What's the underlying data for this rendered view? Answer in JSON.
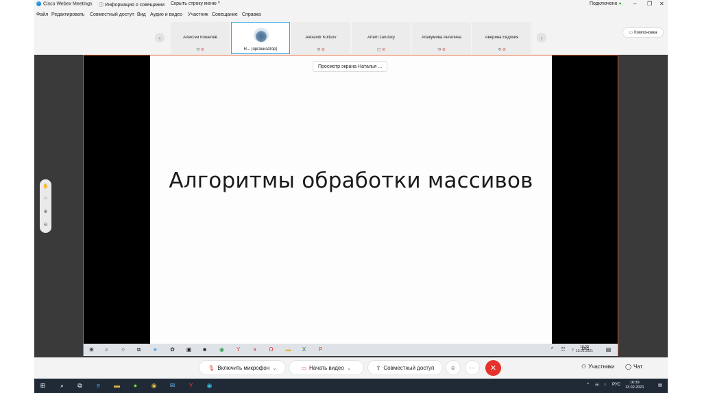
{
  "titlebar": {
    "app_title": "Cisco Webex Meetings",
    "meeting_info": "Информация о совещании",
    "hide_menu": "Скрыть строку меню ^",
    "status": "Подключено",
    "status_color": "#2dbb4d"
  },
  "menu": [
    "Файл",
    "Редактировать",
    "Совместный доступ",
    "Вид",
    "Аудио и видео",
    "Участник",
    "Совещание",
    "Справка"
  ],
  "participants": [
    {
      "name": "Алексей Кошелев",
      "icons": "⟲ ⊘"
    },
    {
      "name": "Н...  (организатор)",
      "icons": "⟲"
    },
    {
      "name": "Alexandr Koltsov",
      "icons": "⟲ ⊘"
    },
    {
      "name": "Artem zarutsky",
      "icons": "▢ ⊘"
    },
    {
      "name": "Абакумова Ангелина",
      "icons": "⟲ ⊘"
    },
    {
      "name": "Аверина Евдокия",
      "icons": "⟲ ⊘"
    }
  ],
  "layout_button": "Компоновка",
  "viewing_label": "Просмотр экрана Наталья ...",
  "slide_title": "Алгоритмы обработки массивов",
  "inner_taskbar": {
    "lang": "ENG",
    "time": "16:39",
    "date": "13.02.2021"
  },
  "controls": {
    "mic": "Включить микрофон",
    "video": "Начать видео",
    "share": "Совместный доступ",
    "participants": "Участники",
    "chat": "Чат"
  },
  "outer_taskbar": {
    "lang": "РУС",
    "time": "16:39",
    "date": "13.02.2021"
  }
}
